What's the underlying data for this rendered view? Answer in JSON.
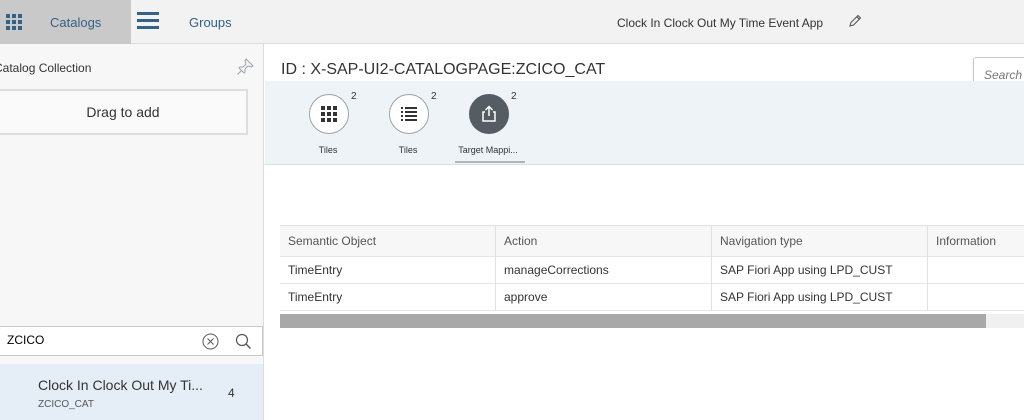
{
  "topbar": {
    "catalogs_label": "Catalogs",
    "groups_label": "Groups",
    "app_title": "Clock In Clock Out My Time Event App",
    "catalogs_icon": "app-grid-icon",
    "menu_icon": "hamburger-menu-icon",
    "edit_icon": "pencil-icon"
  },
  "left_pane": {
    "title": "Catalog Collection",
    "pin_icon": "pin-icon",
    "drop_zone_text": "Drag to add",
    "search": {
      "value": "ZCICO",
      "clear_icon": "clear-icon",
      "search_icon": "search-icon"
    },
    "catalog_items": [
      {
        "title": "Clock In Clock Out My Ti...",
        "subtitle": "ZCICO_CAT",
        "count": "4"
      }
    ]
  },
  "main": {
    "page_id": "ID : X-SAP-UI2-CATALOGPAGE:ZCICO_CAT",
    "search_placeholder": "Search",
    "icon_tabs": [
      {
        "label": "Tiles",
        "count": "2",
        "icon": "tiles-grid-icon",
        "selected": false
      },
      {
        "label": "Tiles",
        "count": "2",
        "icon": "tiles-list-icon",
        "selected": false
      },
      {
        "label": "Target Mappi...",
        "count": "2",
        "icon": "target-mapping-share-icon",
        "selected": true
      }
    ],
    "table": {
      "columns": [
        "Semantic Object",
        "Action",
        "Navigation type",
        "Information"
      ],
      "rows": [
        [
          "TimeEntry",
          "manageCorrections",
          "SAP Fiori App using LPD_CUST",
          ""
        ],
        [
          "TimeEntry",
          "approve",
          "SAP Fiori App using LPD_CUST",
          ""
        ]
      ]
    }
  },
  "colors": {
    "brand_link": "#346187",
    "selected_tab_bg": "#c9c9c9",
    "selected_item_bg": "#e5eef6",
    "icon_tab_bar_bg": "#eef3f8"
  }
}
